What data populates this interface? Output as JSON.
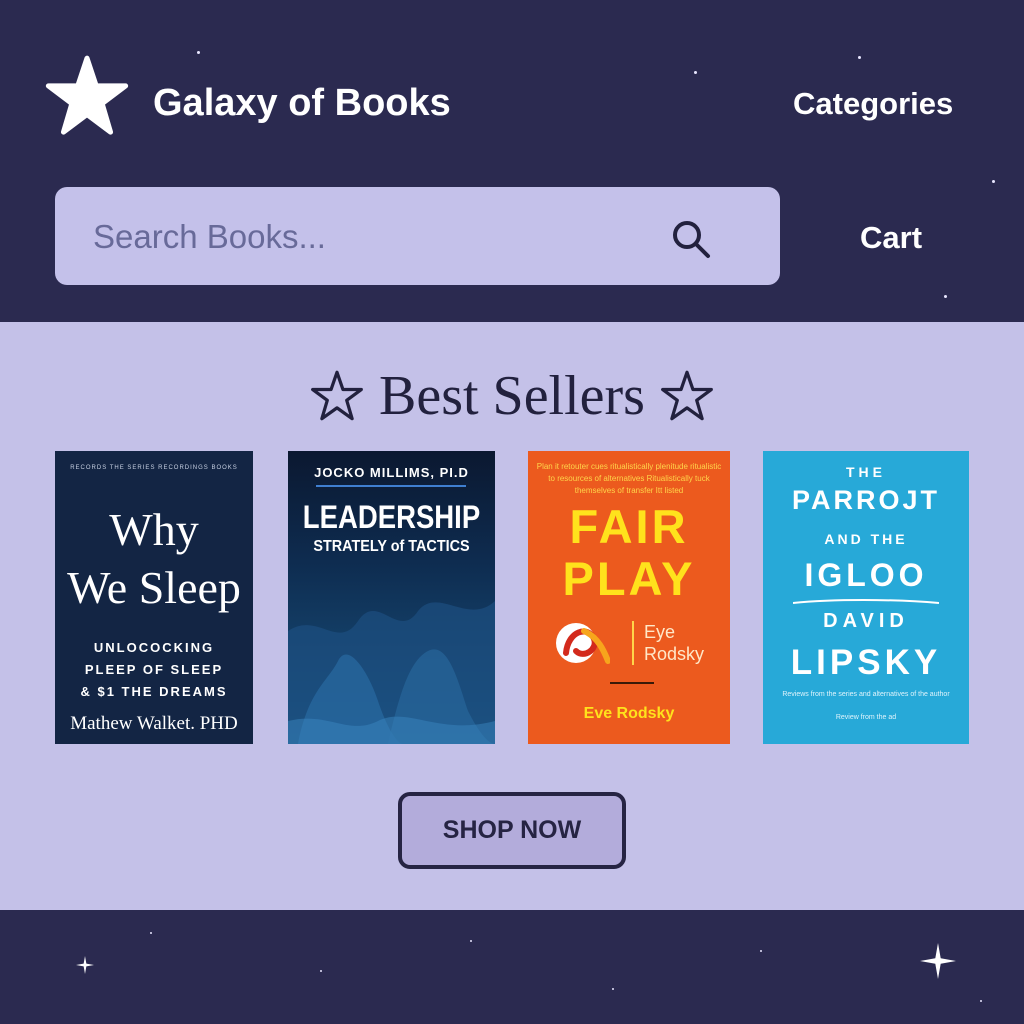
{
  "header": {
    "brand": "Galaxy of Books",
    "nav_categories": "Categories",
    "nav_cart": "Cart",
    "search": {
      "placeholder": "Search Books...",
      "value": ""
    }
  },
  "main": {
    "section_title": "Best Sellers",
    "books": [
      {
        "top_text": "RECORDS THE SERIES RECORDINGS BOOKS",
        "title_line1": "Why",
        "title_line2": "We Sleep",
        "subtitle_line1": "UNLOCOCKING",
        "subtitle_line2": "PLEEP OF SLEEP",
        "subtitle_line3": "& $1 THE DREAMS",
        "author": "Mathew Walket. PHD"
      },
      {
        "author": "JOCKO MILLIMS, PI.D",
        "title": "LEADERSHIP",
        "subtitle": "STRATELY of TACTICS"
      },
      {
        "top_text": "Plan it retouter cues ritualistically plenitude ritualistic to resources of alternatives Ritualistically tuck themselves of transfer Itt listed",
        "title_line1": "FAIR",
        "title_line2": "PLAY",
        "logo_text_line1": "Eye",
        "logo_text_line2": "Rodsky",
        "author": "Eve Rodsky"
      },
      {
        "the": "THE",
        "title": "PARROJT",
        "and_the": "AND THE",
        "title2": "IGLOO",
        "author_first": "DAVID",
        "author_last": "LIPSKY",
        "small_text1": "Reviews from the series and alternatives of the author",
        "small_text2": "Review from the ad"
      }
    ],
    "shop_button": "SHOP NOW"
  },
  "colors": {
    "night": "#2b2a50",
    "lavender": "#c4c1e8",
    "button": "#b3acdb"
  },
  "icons": [
    "star-logo-icon",
    "search-icon",
    "star-outline-icon",
    "sparkle-icon"
  ]
}
